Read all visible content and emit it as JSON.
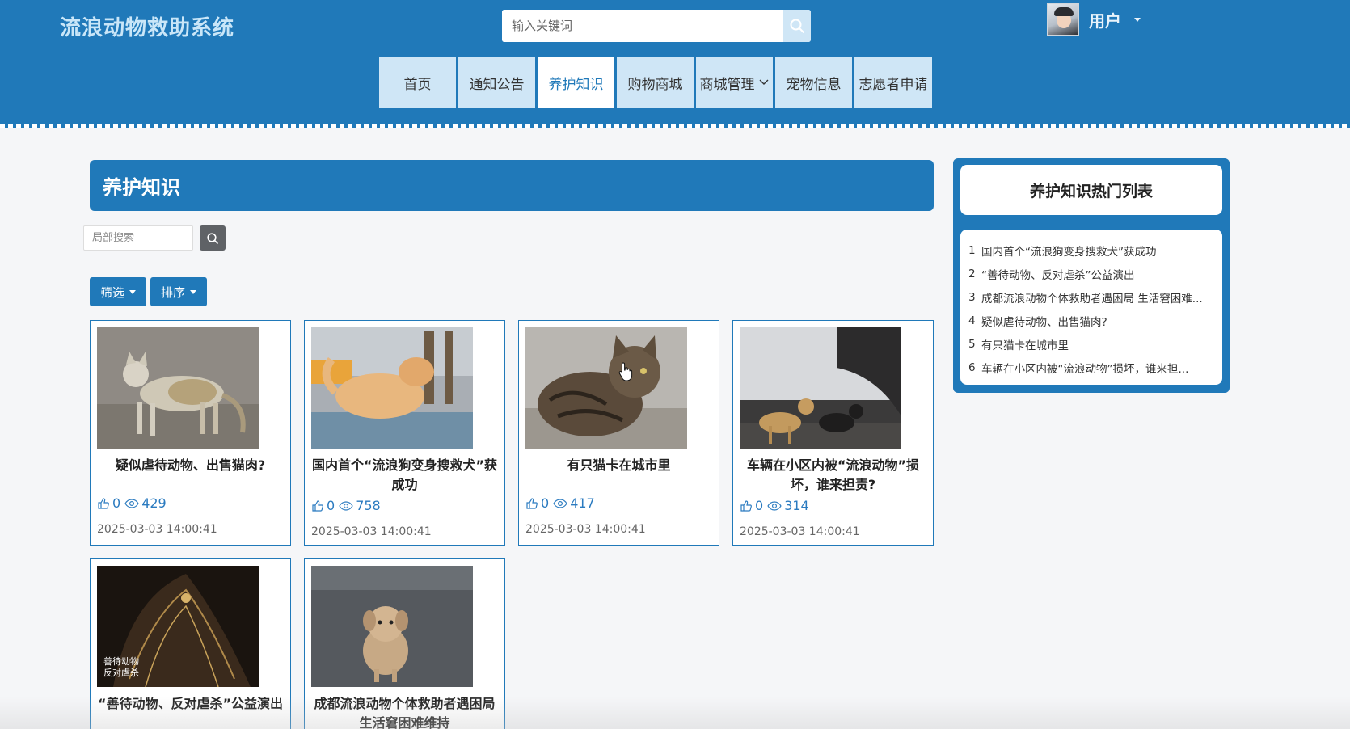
{
  "header": {
    "brand": "流浪动物救助系统",
    "search_placeholder": "输入关键词",
    "user_name": "用户"
  },
  "nav": [
    {
      "label": "首页",
      "active": false
    },
    {
      "label": "通知公告",
      "active": false
    },
    {
      "label": "养护知识",
      "active": true
    },
    {
      "label": "购物商城",
      "active": false
    },
    {
      "label": "商城管理",
      "active": false
    },
    {
      "label": "宠物信息",
      "active": false
    },
    {
      "label": "志愿者申请",
      "active": false
    }
  ],
  "main": {
    "title": "养护知识",
    "local_search_placeholder": "局部搜索",
    "filter_label": "筛选",
    "sort_label": "排序",
    "cards": [
      {
        "title": "疑似虐待动物、出售猫肉?",
        "likes": "0",
        "views": "429",
        "date": "2025-03-03 14:00:41"
      },
      {
        "title": "国内首个“流浪狗变身搜救犬”获成功",
        "likes": "0",
        "views": "758",
        "date": "2025-03-03 14:00:41"
      },
      {
        "title": "有只猫卡在城市里",
        "likes": "0",
        "views": "417",
        "date": "2025-03-03 14:00:41"
      },
      {
        "title": "车辆在小区内被“流浪动物”损坏，谁来担责?",
        "likes": "0",
        "views": "314",
        "date": "2025-03-03 14:00:41"
      },
      {
        "title": "“善待动物、反对虐杀”公益演出",
        "image_text": [
          "善待动物",
          "反对虐杀"
        ]
      },
      {
        "title": "成都流浪动物个体救助者遇困局 生活窘困难维持"
      }
    ]
  },
  "sidebar": {
    "title": "养护知识热门列表",
    "items": [
      {
        "num": "1",
        "text": "国内首个“流浪狗变身搜救犬”获成功"
      },
      {
        "num": "2",
        "text": "“善待动物、反对虐杀”公益演出"
      },
      {
        "num": "3",
        "text": "成都流浪动物个体救助者遇困局 生活窘困难..."
      },
      {
        "num": "4",
        "text": "疑似虐待动物、出售猫肉?"
      },
      {
        "num": "5",
        "text": "有只猫卡在城市里"
      },
      {
        "num": "6",
        "text": "车辆在小区内被“流浪动物”损坏，谁来担..."
      }
    ]
  },
  "colors": {
    "primary": "#2079b9",
    "nav_bg": "#cfe6f6",
    "brand_text": "#c9e6f8"
  }
}
